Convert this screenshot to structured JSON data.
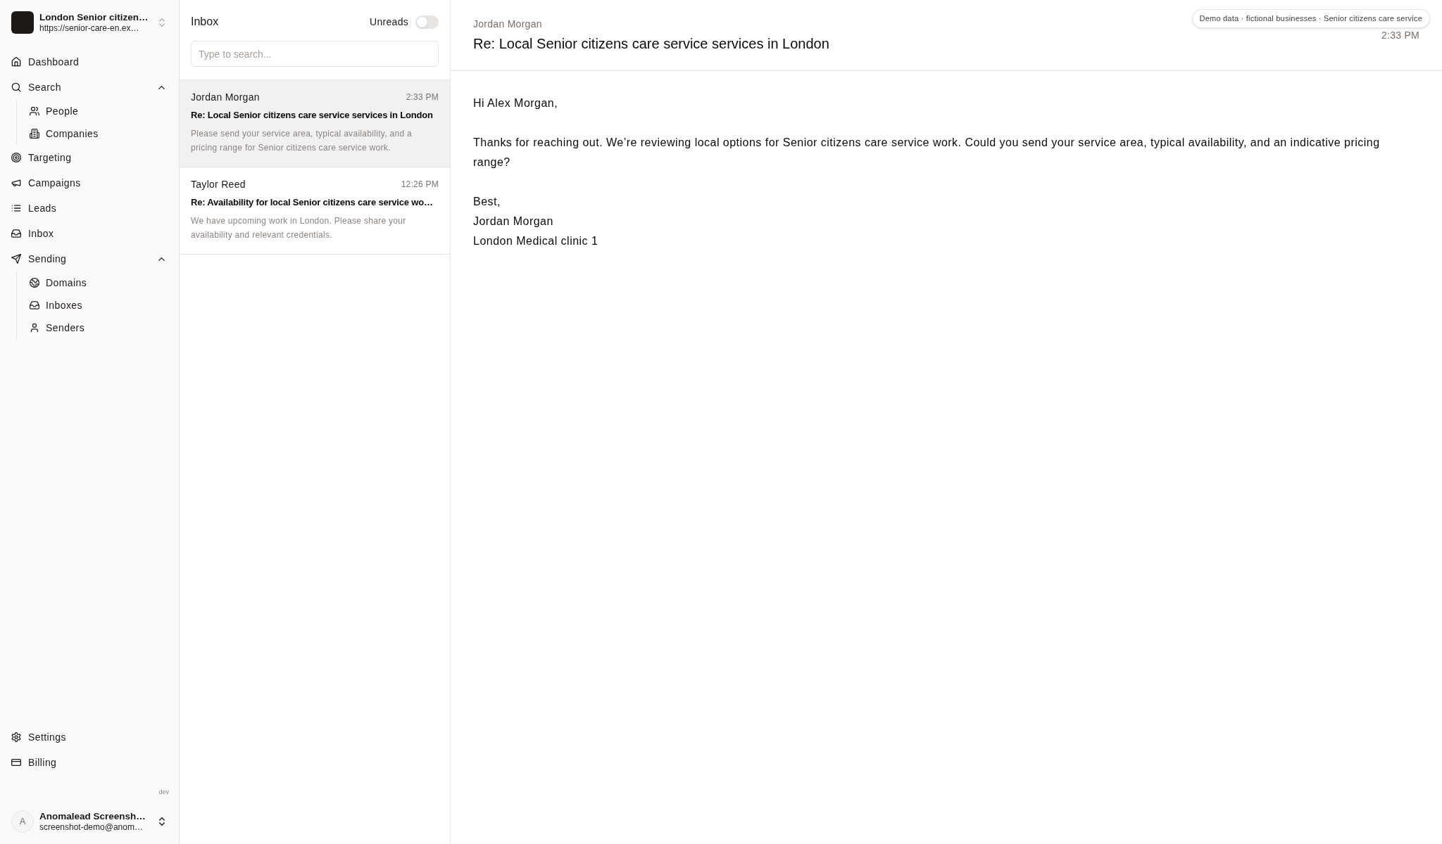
{
  "workspace": {
    "name": "London Senior citizen…",
    "url": "https://senior-care-en.ex…"
  },
  "nav": [
    {
      "label": "Dashboard"
    },
    {
      "label": "Search",
      "expanded": true,
      "children": [
        {
          "label": "People"
        },
        {
          "label": "Companies"
        }
      ]
    },
    {
      "label": "Targeting"
    },
    {
      "label": "Campaigns"
    },
    {
      "label": "Leads"
    },
    {
      "label": "Inbox"
    },
    {
      "label": "Sending",
      "expanded": true,
      "children": [
        {
          "label": "Domains"
        },
        {
          "label": "Inboxes"
        },
        {
          "label": "Senders"
        }
      ]
    }
  ],
  "footer_nav": [
    {
      "label": "Settings"
    },
    {
      "label": "Billing"
    }
  ],
  "environment": "dev",
  "account": {
    "initial": "A",
    "name": "Anomalead Screensh…",
    "email": "screenshot-demo@anom…"
  },
  "inbox": {
    "title": "Inbox",
    "unreads_filter": {
      "label": "Unreads",
      "on": false
    },
    "search": {
      "placeholder": "Type to search..."
    },
    "messages": [
      {
        "sender": "Jordan Morgan",
        "time": "2:33 PM",
        "subject": "Re: Local Senior citizens care service services in London",
        "preview": "Please send your service area, typical availability, and a pricing range for Senior citizens care service work.",
        "selected": true
      },
      {
        "sender": "Taylor Reed",
        "time": "12:26 PM",
        "subject": "Re: Availability for local Senior citizens care service wo…",
        "preview": "We have upcoming work in London. Please share your availability and relevant credentials.",
        "selected": false
      }
    ]
  },
  "message": {
    "sender": "Jordan Morgan",
    "subject": "Re: Local Senior citizens care service services in London",
    "time": "2:33 PM",
    "paragraphs": [
      [
        "Hi Alex Morgan,"
      ],
      [
        "Thanks for reaching out. We’re reviewing local options for Senior citizens care service work. Could you send your service area, typical availability, and an indicative pricing range?"
      ],
      [
        "Best,",
        "Jordan Morgan",
        "London Medical clinic 1"
      ]
    ]
  },
  "demo_badge": "Demo data · fictional businesses · Senior citizens care service"
}
